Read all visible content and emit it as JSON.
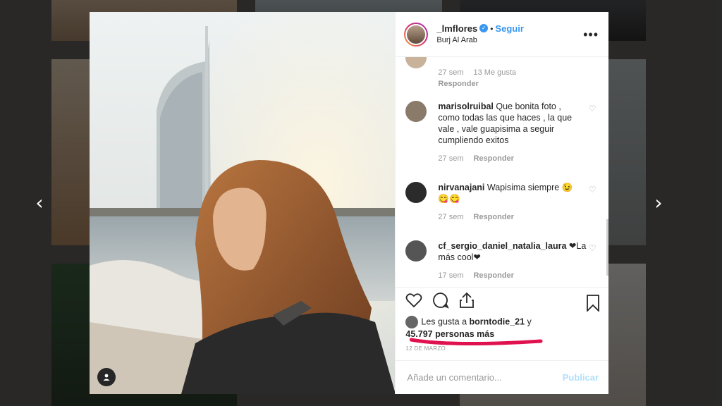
{
  "colors": {
    "accent": "#3897f0",
    "text": "#262626",
    "muted": "#999999",
    "underline": "#e0114f"
  },
  "navigation": {
    "prev_icon": "chevron-left-icon",
    "next_icon": "chevron-right-icon",
    "prev_glyph": "‹",
    "next_glyph": "›"
  },
  "post": {
    "username": "_lmflores",
    "verified": true,
    "dot": "•",
    "follow_label": "Seguir",
    "location": "Burj Al Arab",
    "more_label": "•••"
  },
  "comments": [
    {
      "username": "",
      "text": "",
      "time": "27 sem",
      "likes": "13 Me gusta",
      "reply": "Responder",
      "avatar_color": "#c9b29a"
    },
    {
      "username": "marisolruibal",
      "text": "Que bonita foto , como todas las que haces , la que vale , vale guapisima a seguir cumpliendo exitos",
      "time": "27 sem",
      "likes": "",
      "reply": "Responder",
      "avatar_color": "#8a7a6a"
    },
    {
      "username": "nirvanajani",
      "text": "Wapisima siempre 😉😋😋",
      "time": "27 sem",
      "likes": "",
      "reply": "Responder",
      "avatar_color": "#2b2b2b"
    },
    {
      "username": "cf_sergio_daniel_natalia_laura",
      "text": "❤La más cool❤",
      "time": "17 sem",
      "likes": "",
      "reply": "Responder",
      "avatar_color": "#555555"
    }
  ],
  "likes_line": {
    "prefix": "Les gusta a",
    "user": "borntodie_21",
    "joiner": "y",
    "count": "45.797 personas más"
  },
  "date": "12 DE MARZO",
  "add_comment": {
    "placeholder": "Añade un comentario...",
    "publish_label": "Publicar"
  },
  "icons": {
    "like": "heart-icon",
    "comment": "comment-icon",
    "share": "share-icon",
    "save": "bookmark-icon",
    "more": "more-options-icon",
    "user_tag": "user-tag-icon"
  }
}
